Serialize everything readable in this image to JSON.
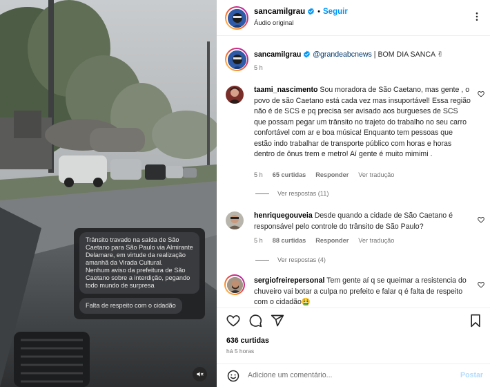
{
  "media": {
    "overlay_message": "Trânsito travado na saída de São Caetano para São Paulo via Almirante Delamare, em virtude da realização amanhã da Virada Cultural.\nNenhum aviso da prefeitura de São Caetano sobre a interdição, pegando todo mundo de surpresa",
    "overlay_reply": "Falta de respeito com o cidadão",
    "mute_icon": "speaker-muted-icon"
  },
  "header": {
    "username": "sancamilgrau",
    "dot": "•",
    "follow_label": "Seguir",
    "audio_label": "Áudio original"
  },
  "caption": {
    "username": "sancamilgrau",
    "mention": "@grandeabcnews",
    "text": " | BOM DIA SANCA ✌",
    "time": "5 h"
  },
  "comments": [
    {
      "username": "taami_nascimento",
      "text": "Sou moradora de São Caetano, mas gente , o povo de são Caetano está cada vez mas insuportável! Essa região não é de SCS e pq precisa ser avisado aos burgueses de SCS que possam pegar um trânsito no trajeto do trabalho no seu carro confortável com ar e boa música! Enquanto tem pessoas que estão indo trabalhar de transporte público com horas e horas dentro de ônus trem e metro! Aí gente é muito mimimi .",
      "time": "5 h",
      "likes": "65 curtidas",
      "reply": "Responder",
      "translate": "Ver tradução",
      "view_replies": "Ver respostas (11)"
    },
    {
      "username": "henriquegouveia",
      "text": "Desde quando a cidade de São Caetano é responsável pelo controle do trânsito de São Paulo?",
      "time": "5 h",
      "likes": "88 curtidas",
      "reply": "Responder",
      "translate": "Ver tradução",
      "view_replies": "Ver respostas (4)"
    },
    {
      "username": "sergiofreirepersonal",
      "text": "Tem gente aí q se queimar a resistencia do chuveiro vai botar a culpa no prefeito e falar q é falta de respeito com o cidadão🤮"
    }
  ],
  "actions": {
    "likes": "636 curtidas",
    "ago": "há 5 horas",
    "comment_placeholder": "Adicione um comentário...",
    "post_label": "Postar"
  },
  "colors": {
    "follow_blue": "#0095f6",
    "muted_text": "#737373",
    "verified_blue": "#0095f6",
    "post_disabled": "#b3dbff"
  }
}
